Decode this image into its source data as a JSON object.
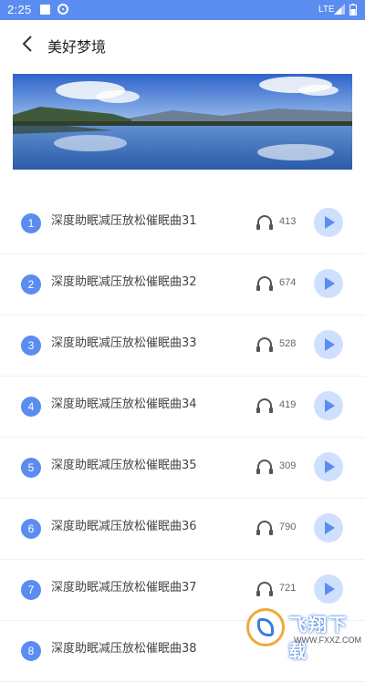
{
  "status_bar": {
    "time": "2:25",
    "network": "LTE"
  },
  "header": {
    "title": "美好梦境",
    "back_icon": "chevron-left-icon"
  },
  "banner": {
    "image": "lake-landscape"
  },
  "colors": {
    "accent": "#5b8df0",
    "play_bg": "#cfe0ff"
  },
  "tracks": [
    {
      "index": "1",
      "title": "深度助眠减压放松催眠曲31",
      "plays": "413"
    },
    {
      "index": "2",
      "title": "深度助眠减压放松催眠曲32",
      "plays": "674"
    },
    {
      "index": "3",
      "title": "深度助眠减压放松催眠曲33",
      "plays": "528"
    },
    {
      "index": "4",
      "title": "深度助眠减压放松催眠曲34",
      "plays": "419"
    },
    {
      "index": "5",
      "title": "深度助眠减压放松催眠曲35",
      "plays": "309"
    },
    {
      "index": "6",
      "title": "深度助眠减压放松催眠曲36",
      "plays": "790"
    },
    {
      "index": "7",
      "title": "深度助眠减压放松催眠曲37",
      "plays": "721"
    },
    {
      "index": "8",
      "title": "深度助眠减压放松催眠曲38",
      "plays": ""
    }
  ],
  "watermark": {
    "text": "飞翔下载",
    "url": "WWW.FXXZ.COM"
  }
}
